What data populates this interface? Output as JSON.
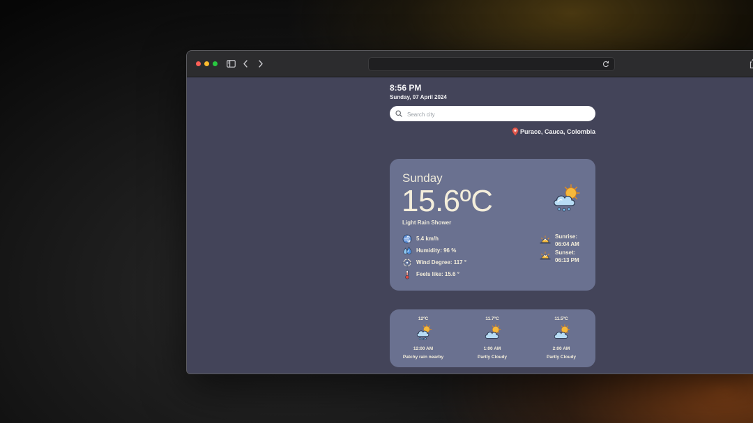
{
  "header": {
    "time": "8:56 PM",
    "date": "Sunday, 07 April 2024"
  },
  "search": {
    "placeholder": "Search city",
    "value": ""
  },
  "location": {
    "text": "Purace, Cauca, Colombia",
    "icon": "map-pin-icon"
  },
  "current": {
    "day": "Sunday",
    "temperature": "15.6ºC",
    "condition": "Light Rain Shower",
    "icon": "sun-cloud-rain-icon",
    "stats": [
      {
        "icon": "wind-icon",
        "text": "5.4 km/h"
      },
      {
        "icon": "droplets-icon",
        "text": "Humidity: 96 %"
      },
      {
        "icon": "compass-icon",
        "text": "Wind Degree: 117 °"
      },
      {
        "icon": "thermometer-icon",
        "text": "Feels like: 15.6 °"
      }
    ],
    "sunrise": {
      "label": "Sunrise:",
      "time": "06:04 AM",
      "icon": "sunrise-icon"
    },
    "sunset": {
      "label": "Sunset:",
      "time": "06:13 PM",
      "icon": "sunset-icon"
    }
  },
  "forecast": [
    {
      "temp": "12ºC",
      "time": "12:00 AM",
      "desc": "Patchy rain nearby",
      "icon": "sun-cloud-rain-icon"
    },
    {
      "temp": "11.7ºC",
      "time": "1:00 AM",
      "desc": "Partly Cloudy",
      "icon": "partly-cloudy-icon"
    },
    {
      "temp": "11.5ºC",
      "time": "2:00 AM",
      "desc": "Partly Cloudy",
      "icon": "partly-cloudy-icon"
    }
  ],
  "colors": {
    "page_background": "#434459",
    "card_background": "#6a7190",
    "text_cream": "#f4eedb"
  }
}
